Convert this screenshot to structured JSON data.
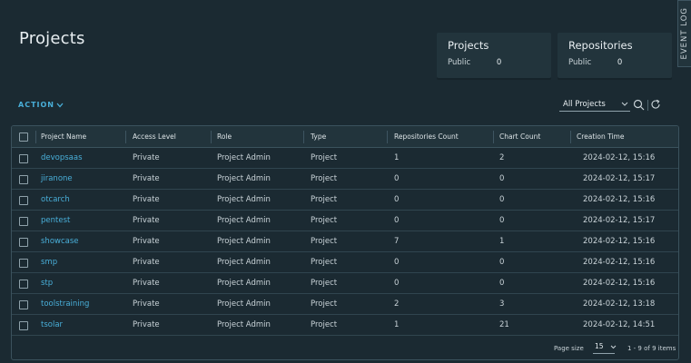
{
  "page": {
    "title": "Projects"
  },
  "summary": {
    "projects": {
      "title": "Projects",
      "label": "Public",
      "value": "0"
    },
    "repositories": {
      "title": "Repositories",
      "label": "Public",
      "value": "0"
    }
  },
  "event_log": {
    "label": "EVENT LOG"
  },
  "toolbar": {
    "action_label": "ACTION",
    "filter_value": "All Projects"
  },
  "icons": {
    "action_chevron": "chevron-down-icon",
    "search": "search-icon",
    "refresh": "refresh-icon",
    "filter_caret": "chevron-down-icon"
  },
  "table": {
    "columns": [
      "Project Name",
      "Access Level",
      "Role",
      "Type",
      "Repositories Count",
      "Chart Count",
      "Creation Time"
    ],
    "rows": [
      {
        "name": "devopsaas",
        "access": "Private",
        "role": "Project Admin",
        "type": "Project",
        "repos": "1",
        "charts": "2",
        "created": "2024-02-12, 15:16"
      },
      {
        "name": "jiranone",
        "access": "Private",
        "role": "Project Admin",
        "type": "Project",
        "repos": "0",
        "charts": "0",
        "created": "2024-02-12, 15:17"
      },
      {
        "name": "otcarch",
        "access": "Private",
        "role": "Project Admin",
        "type": "Project",
        "repos": "0",
        "charts": "0",
        "created": "2024-02-12, 15:16"
      },
      {
        "name": "pentest",
        "access": "Private",
        "role": "Project Admin",
        "type": "Project",
        "repos": "0",
        "charts": "0",
        "created": "2024-02-12, 15:17"
      },
      {
        "name": "showcase",
        "access": "Private",
        "role": "Project Admin",
        "type": "Project",
        "repos": "7",
        "charts": "1",
        "created": "2024-02-12, 15:16"
      },
      {
        "name": "smp",
        "access": "Private",
        "role": "Project Admin",
        "type": "Project",
        "repos": "0",
        "charts": "0",
        "created": "2024-02-12, 15:16"
      },
      {
        "name": "stp",
        "access": "Private",
        "role": "Project Admin",
        "type": "Project",
        "repos": "0",
        "charts": "0",
        "created": "2024-02-12, 15:16"
      },
      {
        "name": "toolstraining",
        "access": "Private",
        "role": "Project Admin",
        "type": "Project",
        "repos": "2",
        "charts": "3",
        "created": "2024-02-12, 13:18"
      },
      {
        "name": "tsolar",
        "access": "Private",
        "role": "Project Admin",
        "type": "Project",
        "repos": "1",
        "charts": "21",
        "created": "2024-02-12, 14:51"
      }
    ]
  },
  "footer": {
    "page_size_label": "Page size",
    "page_size_value": "15",
    "count_text": "1 - 9 of 9 items"
  },
  "colors": {
    "background": "#1b2a32",
    "card": "#22343c",
    "link": "#49afd9",
    "text": "#c9d3d8"
  }
}
